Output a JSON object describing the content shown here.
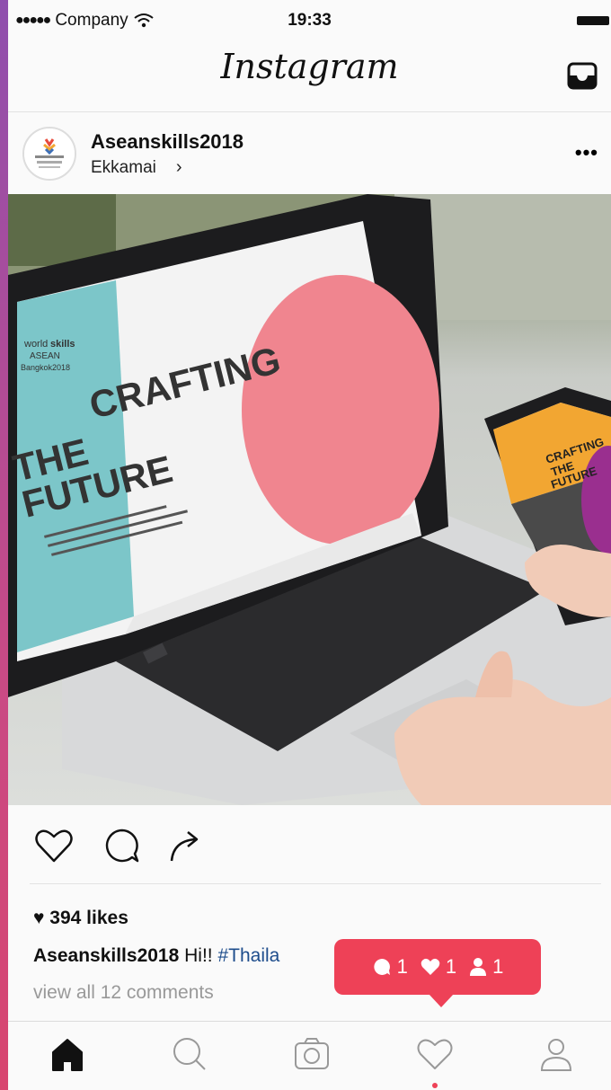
{
  "status_bar": {
    "signal": "●●●●●",
    "carrier": "Company",
    "time": "19:33"
  },
  "header": {
    "title": "Instagram",
    "inbox_icon": "inbox-tray-icon"
  },
  "post": {
    "username": "Aseanskills2018",
    "location": "Ekkamai",
    "location_chevron": "›",
    "more": "•••",
    "image": {
      "screen_text": [
        "CRAFTING",
        "THE",
        "FUTURE"
      ],
      "logo_text": [
        "world",
        "skills",
        "ASEAN",
        "Bangkok2018"
      ],
      "phone_text": [
        "CRAFTING",
        "THE",
        "FUTURE"
      ],
      "colors": {
        "teal": "#7cc6c9",
        "pink": "#f0858f",
        "orange": "#f2a632",
        "purple": "#9a2f8f"
      }
    },
    "likes_text": "♥ 394 likes",
    "caption_user": "Aseanskills2018",
    "caption_text": "Hi!!",
    "caption_tag": "#Thaila",
    "view_comments": "view all 12 comments"
  },
  "notification": {
    "comments_count": "1",
    "likes_count": "1",
    "followers_count": "1",
    "color": "#ee4157"
  },
  "tabs": [
    "home-icon",
    "search-icon",
    "camera-icon",
    "heart-icon",
    "profile-icon"
  ]
}
